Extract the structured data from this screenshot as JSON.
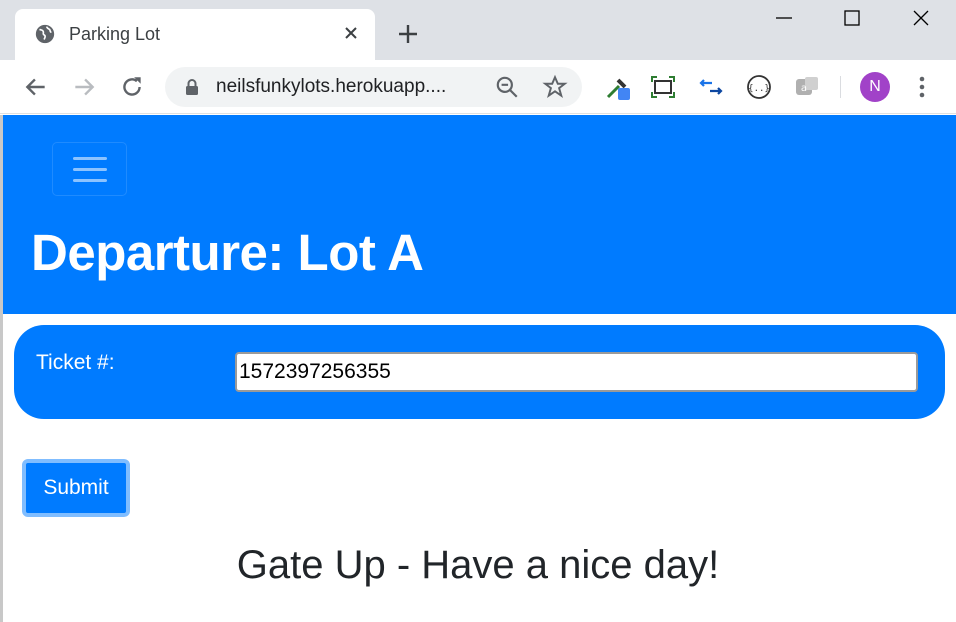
{
  "browser": {
    "tab_title": "Parking Lot",
    "url": "neilsfunkylots.herokuapp....",
    "profile_initial": "N",
    "icons": {
      "favicon": "globe-icon",
      "close_tab": "close-icon",
      "new_tab": "plus-icon",
      "minimize": "minimize-icon",
      "maximize": "maximize-icon",
      "close_window": "close-window-icon",
      "back": "back-arrow-icon",
      "forward": "forward-arrow-icon",
      "reload": "reload-icon",
      "lock": "lock-icon",
      "zoom": "zoom-out-icon",
      "bookmark": "star-icon",
      "extensions": [
        "eyedropper-icon",
        "screenshot-icon",
        "arrows-icon",
        "code-icon",
        "translate-icon"
      ],
      "menu": "more-vert-icon"
    },
    "colors": {
      "avatar": "#a142c8",
      "tabstrip": "#dee1e6"
    }
  },
  "page": {
    "colors": {
      "primary": "#007bff",
      "focus_ring": "#80bdff"
    },
    "title": "Departure: Lot A",
    "ticket": {
      "label": "Ticket #:",
      "value": "1572397256355"
    },
    "submit_label": "Submit",
    "status_message": "Gate Up - Have a nice day!"
  }
}
